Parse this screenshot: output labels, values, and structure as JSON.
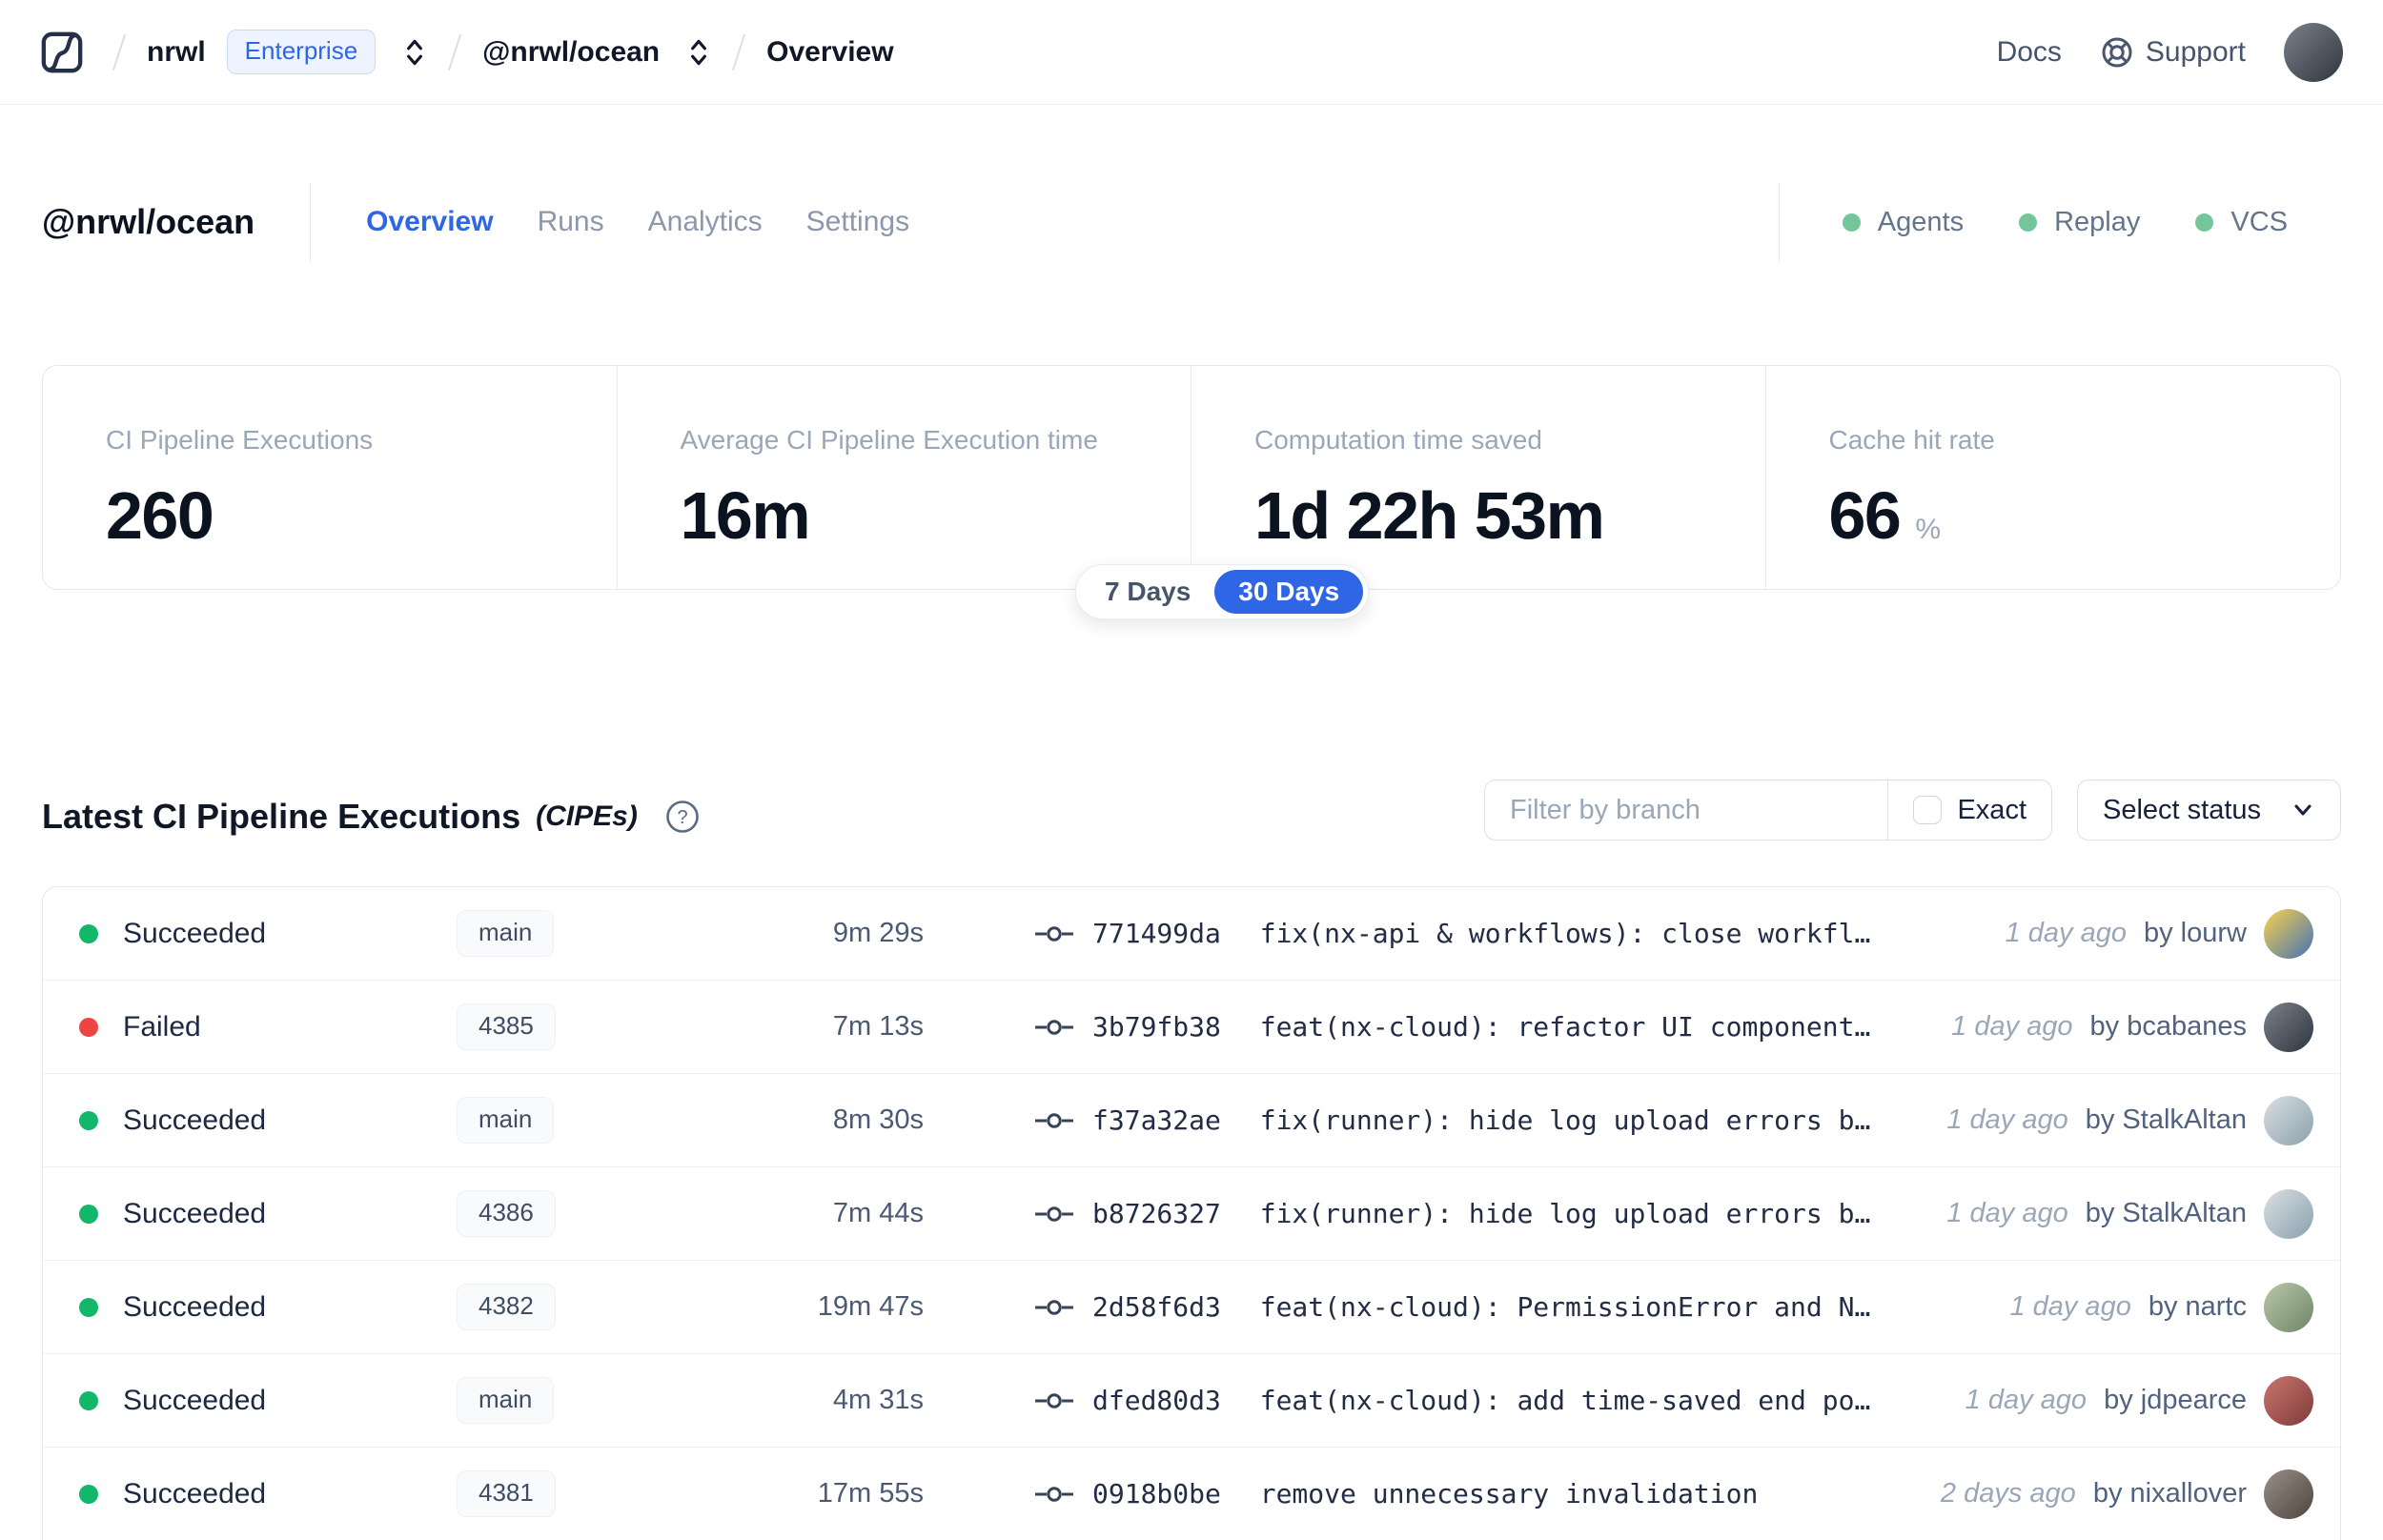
{
  "colors": {
    "accent_blue": "#2f66e5",
    "success_green": "#12b76a",
    "failure_red": "#ef4444",
    "service_green": "#74c69a"
  },
  "navbar": {
    "breadcrumb": {
      "org": "nrwl",
      "org_badge": "Enterprise",
      "workspace": "@nrwl/ocean",
      "page": "Overview"
    },
    "docs_label": "Docs",
    "support_label": "Support",
    "avatar": {
      "from": "#7b828c",
      "to": "#2f353f"
    }
  },
  "workspace_header": {
    "title": "@nrwl/ocean",
    "tabs": [
      {
        "label": "Overview",
        "active": true
      },
      {
        "label": "Runs",
        "active": false
      },
      {
        "label": "Analytics",
        "active": false
      },
      {
        "label": "Settings",
        "active": false
      }
    ],
    "services": [
      {
        "label": "Agents",
        "status": "online"
      },
      {
        "label": "Replay",
        "status": "online"
      },
      {
        "label": "VCS",
        "status": "online"
      }
    ]
  },
  "stats": {
    "cards": [
      {
        "label": "CI Pipeline Executions",
        "value": "260",
        "unit": ""
      },
      {
        "label": "Average CI Pipeline Execution time",
        "value": "16m",
        "unit": ""
      },
      {
        "label": "Computation time saved",
        "value": "1d 22h 53m",
        "unit": ""
      },
      {
        "label": "Cache hit rate",
        "value": "66",
        "unit": "%"
      }
    ],
    "range_toggle": {
      "options": [
        "7 Days",
        "30 Days"
      ],
      "selected": "30 Days"
    }
  },
  "cipe_section": {
    "title": "Latest CI Pipeline Executions",
    "title_suffix": "(CIPEs)",
    "filter": {
      "branch_placeholder": "Filter by branch",
      "exact_label": "Exact",
      "exact_checked": false,
      "status_label": "Select status"
    },
    "rows": [
      {
        "status": "Succeeded",
        "branch": "main",
        "duration": "9m 29s",
        "commit_hash": "771499da",
        "commit_message": "fix(nx-api & workflows): close workfl…",
        "time_ago": "1 day ago",
        "author": "by lourw",
        "avatar": {
          "from": "#f9d24b",
          "to": "#4472b5"
        }
      },
      {
        "status": "Failed",
        "branch": "4385",
        "duration": "7m 13s",
        "commit_hash": "3b79fb38",
        "commit_message": "feat(nx-cloud): refactor UI component…",
        "time_ago": "1 day ago",
        "author": "by bcabanes",
        "avatar": {
          "from": "#7b828c",
          "to": "#2f353f"
        }
      },
      {
        "status": "Succeeded",
        "branch": "main",
        "duration": "8m 30s",
        "commit_hash": "f37a32ae",
        "commit_message": "fix(runner): hide log upload errors b…",
        "time_ago": "1 day ago",
        "author": "by StalkAltan",
        "avatar": {
          "from": "#d9e0e4",
          "to": "#8ba0ac"
        }
      },
      {
        "status": "Succeeded",
        "branch": "4386",
        "duration": "7m 44s",
        "commit_hash": "b8726327",
        "commit_message": "fix(runner): hide log upload errors b…",
        "time_ago": "1 day ago",
        "author": "by StalkAltan",
        "avatar": {
          "from": "#d9e0e4",
          "to": "#8ba0ac"
        }
      },
      {
        "status": "Succeeded",
        "branch": "4382",
        "duration": "19m 47s",
        "commit_hash": "2d58f6d3",
        "commit_message": "feat(nx-cloud): PermissionError and N…",
        "time_ago": "1 day ago",
        "author": "by nartc",
        "avatar": {
          "from": "#b8c9a8",
          "to": "#6f8468"
        }
      },
      {
        "status": "Succeeded",
        "branch": "main",
        "duration": "4m 31s",
        "commit_hash": "dfed80d3",
        "commit_message": "feat(nx-cloud): add time-saved end po…",
        "time_ago": "1 day ago",
        "author": "by jdpearce",
        "avatar": {
          "from": "#c9766d",
          "to": "#7e3b3a"
        }
      },
      {
        "status": "Succeeded",
        "branch": "4381",
        "duration": "17m 55s",
        "commit_hash": "0918b0be",
        "commit_message": "remove unnecessary invalidation",
        "time_ago": "2 days ago",
        "author": "by nixallover",
        "avatar": {
          "from": "#9b9088",
          "to": "#4e443e"
        }
      }
    ]
  }
}
